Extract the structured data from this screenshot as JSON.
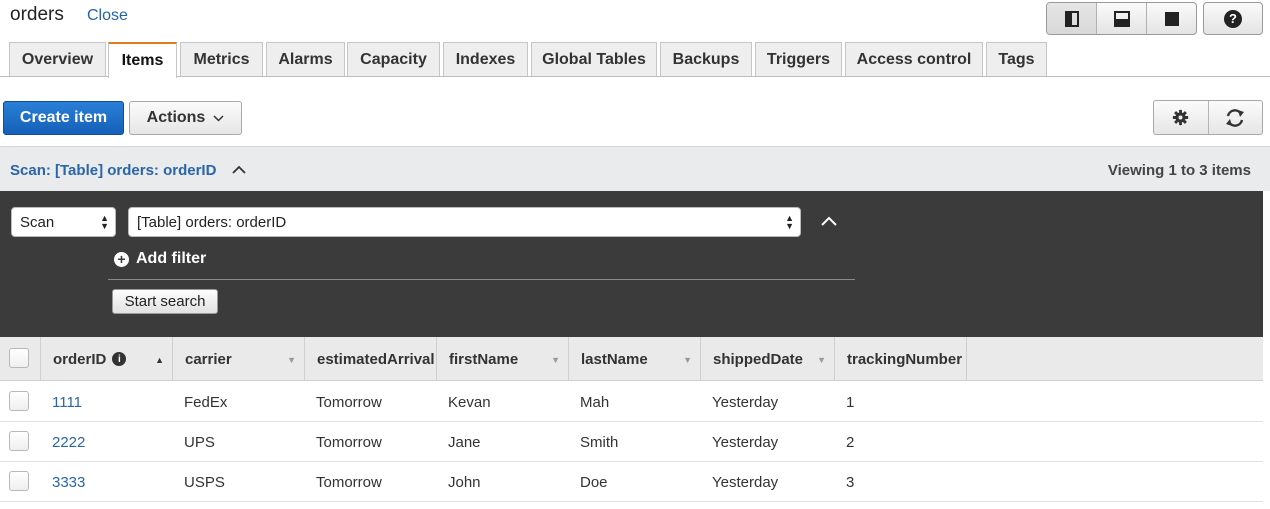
{
  "header": {
    "title": "orders",
    "close_label": "Close"
  },
  "tabs": [
    {
      "label": "Overview",
      "active": false
    },
    {
      "label": "Items",
      "active": true
    },
    {
      "label": "Metrics",
      "active": false
    },
    {
      "label": "Alarms",
      "active": false
    },
    {
      "label": "Capacity",
      "active": false
    },
    {
      "label": "Indexes",
      "active": false
    },
    {
      "label": "Global Tables",
      "active": false
    },
    {
      "label": "Backups",
      "active": false
    },
    {
      "label": "Triggers",
      "active": false
    },
    {
      "label": "Access control",
      "active": false
    },
    {
      "label": "Tags",
      "active": false
    }
  ],
  "toolbar": {
    "create_label": "Create item",
    "actions_label": "Actions",
    "accent_color": "#1a6cc8"
  },
  "scan": {
    "header_label": "Scan: [Table] orders: orderID",
    "viewing_text": "Viewing 1 to 3 items",
    "mode_value": "Scan",
    "target_value": "[Table] orders: orderID",
    "add_filter_label": "Add filter",
    "start_search_label": "Start search"
  },
  "table": {
    "columns": [
      "orderID",
      "carrier",
      "estimatedArrival",
      "firstName",
      "lastName",
      "shippedDate",
      "trackingNumber"
    ],
    "rows": [
      [
        "1111",
        "FedEx",
        "Tomorrow",
        "Kevan",
        "Mah",
        "Yesterday",
        "1"
      ],
      [
        "2222",
        "UPS",
        "Tomorrow",
        "Jane",
        "Smith",
        "Yesterday",
        "2"
      ],
      [
        "3333",
        "USPS",
        "Tomorrow",
        "John",
        "Doe",
        "Yesterday",
        "3"
      ]
    ]
  },
  "icons": {
    "view_split_right": "panel-split-icon",
    "view_split_bottom": "panel-bottom-icon",
    "view_full": "panel-full-icon",
    "help": "help-icon",
    "settings": "gear-icon",
    "refresh": "refresh-icon"
  }
}
